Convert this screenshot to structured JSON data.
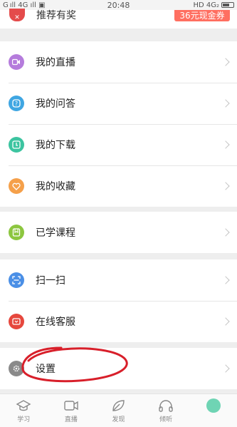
{
  "status_bar": {
    "left": "G ıll  4G ıll  ▣",
    "time": "20:48",
    "right": "HD 4G₂"
  },
  "recommend": {
    "label": "推荐有奖",
    "coupon": "36元现金券"
  },
  "groups": [
    {
      "items": [
        {
          "label": "我的直播",
          "icon": "live-video-icon",
          "color": "#b57cdc"
        },
        {
          "label": "我的问答",
          "icon": "question-icon",
          "color": "#3fa6e2"
        },
        {
          "label": "我的下载",
          "icon": "download-icon",
          "color": "#3cc4a0"
        },
        {
          "label": "我的收藏",
          "icon": "favorite-heart-icon",
          "color": "#f5a04a"
        }
      ]
    },
    {
      "items": [
        {
          "label": "已学课程",
          "icon": "course-bookmark-icon",
          "color": "#8cc63f"
        }
      ]
    },
    {
      "items": [
        {
          "label": "扫一扫",
          "icon": "scan-icon",
          "color": "#4a8fe6"
        },
        {
          "label": "在线客服",
          "icon": "customer-service-icon",
          "color": "#e6473d"
        }
      ]
    },
    {
      "items": [
        {
          "label": "设置",
          "icon": "settings-gear-icon",
          "color": "#8a8a8a"
        }
      ]
    }
  ],
  "tabs": [
    {
      "label": "学习",
      "icon": "study-cap-icon"
    },
    {
      "label": "直播",
      "icon": "video-camera-icon"
    },
    {
      "label": "发现",
      "icon": "discover-leaf-icon"
    },
    {
      "label": "倾听",
      "icon": "headphones-icon"
    },
    {
      "label": "",
      "icon": "profile-icon",
      "active": true
    }
  ],
  "colors": {
    "accent": "#6fd4b4",
    "coupon": "#ff6f61",
    "annotation": "#d81f2a"
  }
}
